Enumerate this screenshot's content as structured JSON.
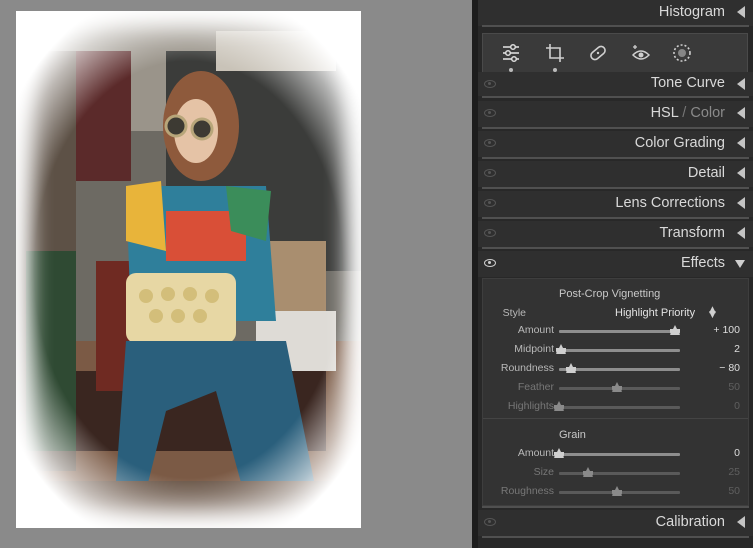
{
  "panels": {
    "histogram": "Histogram",
    "tone_curve": "Tone Curve",
    "hsl": "HSL",
    "hsl_sep": " / ",
    "color": "Color",
    "color_grading": "Color Grading",
    "detail": "Detail",
    "lens_corrections": "Lens Corrections",
    "transform": "Transform",
    "effects": "Effects",
    "calibration": "Calibration"
  },
  "tools": [
    "sliders-icon",
    "crop-icon",
    "healing-icon",
    "redeye-icon",
    "masking-icon"
  ],
  "effects": {
    "vignetting_title": "Post-Crop Vignetting",
    "style_label": "Style",
    "style_value": "Highlight Priority",
    "vignette_sliders": [
      {
        "label": "Amount",
        "value": "+ 100",
        "position": 1.0,
        "enabled": true
      },
      {
        "label": "Midpoint",
        "value": "2",
        "position": 0.02,
        "enabled": true
      },
      {
        "label": "Roundness",
        "value": "− 80",
        "position": 0.1,
        "enabled": true
      },
      {
        "label": "Feather",
        "value": "50",
        "position": 0.5,
        "enabled": false
      },
      {
        "label": "Highlights",
        "value": "0",
        "position": 0.0,
        "enabled": false
      }
    ],
    "grain_title": "Grain",
    "grain_sliders": [
      {
        "label": "Amount",
        "value": "0",
        "position": 0.0,
        "enabled": true
      },
      {
        "label": "Size",
        "value": "25",
        "position": 0.25,
        "enabled": false
      },
      {
        "label": "Roughness",
        "value": "50",
        "position": 0.5,
        "enabled": false
      }
    ]
  },
  "colors": {
    "panel_bg": "#282828",
    "canvas_bg": "#8a8a8a",
    "text_bright": "#d9d9d9"
  }
}
